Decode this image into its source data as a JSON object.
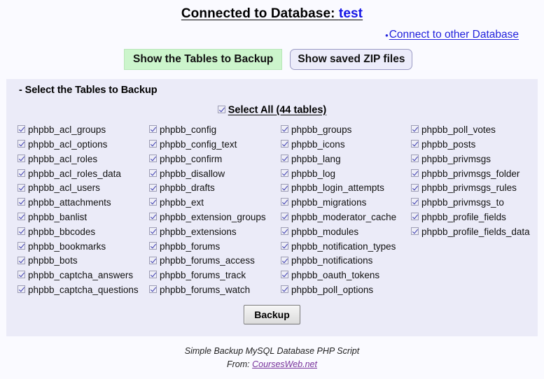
{
  "header": {
    "title_prefix": "Connected to Database: ",
    "database_name": "test",
    "connect_other_link": "Connect to other Database",
    "bullet": "•"
  },
  "toolbar": {
    "show_tables_label": "Show the Tables to Backup",
    "show_zip_label": "Show saved ZIP files",
    "show_tables_color": "#ccf5cc",
    "show_zip_color": "#ececfa"
  },
  "panel": {
    "heading": "- Select the Tables to Backup",
    "select_all_label": "Select All (44 tables)",
    "select_all_checked": true,
    "backup_label": "Backup",
    "columns": [
      {
        "items": [
          {
            "label": "phpbb_acl_groups",
            "checked": true
          },
          {
            "label": "phpbb_acl_options",
            "checked": true
          },
          {
            "label": "phpbb_acl_roles",
            "checked": true
          },
          {
            "label": "phpbb_acl_roles_data",
            "checked": true
          },
          {
            "label": "phpbb_acl_users",
            "checked": true
          },
          {
            "label": "phpbb_attachments",
            "checked": true
          },
          {
            "label": "phpbb_banlist",
            "checked": true
          },
          {
            "label": "phpbb_bbcodes",
            "checked": true
          },
          {
            "label": "phpbb_bookmarks",
            "checked": true
          },
          {
            "label": "phpbb_bots",
            "checked": true
          },
          {
            "label": "phpbb_captcha_answers",
            "checked": true
          },
          {
            "label": "phpbb_captcha_questions",
            "checked": true
          }
        ]
      },
      {
        "items": [
          {
            "label": "phpbb_config",
            "checked": true
          },
          {
            "label": "phpbb_config_text",
            "checked": true
          },
          {
            "label": "phpbb_confirm",
            "checked": true
          },
          {
            "label": "phpbb_disallow",
            "checked": true
          },
          {
            "label": "phpbb_drafts",
            "checked": true
          },
          {
            "label": "phpbb_ext",
            "checked": true
          },
          {
            "label": "phpbb_extension_groups",
            "checked": true
          },
          {
            "label": "phpbb_extensions",
            "checked": true
          },
          {
            "label": "phpbb_forums",
            "checked": true
          },
          {
            "label": "phpbb_forums_access",
            "checked": true
          },
          {
            "label": "phpbb_forums_track",
            "checked": true
          },
          {
            "label": "phpbb_forums_watch",
            "checked": true
          }
        ]
      },
      {
        "items": [
          {
            "label": "phpbb_groups",
            "checked": true
          },
          {
            "label": "phpbb_icons",
            "checked": true
          },
          {
            "label": "phpbb_lang",
            "checked": true
          },
          {
            "label": "phpbb_log",
            "checked": true
          },
          {
            "label": "phpbb_login_attempts",
            "checked": true
          },
          {
            "label": "phpbb_migrations",
            "checked": true
          },
          {
            "label": "phpbb_moderator_cache",
            "checked": true
          },
          {
            "label": "phpbb_modules",
            "checked": true
          },
          {
            "label": "phpbb_notification_types",
            "checked": true
          },
          {
            "label": "phpbb_notifications",
            "checked": true
          },
          {
            "label": "phpbb_oauth_tokens",
            "checked": true
          },
          {
            "label": "phpbb_poll_options",
            "checked": true
          }
        ]
      },
      {
        "items": [
          {
            "label": "phpbb_poll_votes",
            "checked": true
          },
          {
            "label": "phpbb_posts",
            "checked": true
          },
          {
            "label": "phpbb_privmsgs",
            "checked": true
          },
          {
            "label": "phpbb_privmsgs_folder",
            "checked": true
          },
          {
            "label": "phpbb_privmsgs_rules",
            "checked": true
          },
          {
            "label": "phpbb_privmsgs_to",
            "checked": true
          },
          {
            "label": "phpbb_profile_fields",
            "checked": true
          },
          {
            "label": "phpbb_profile_fields_data",
            "checked": true
          }
        ]
      }
    ]
  },
  "footer": {
    "line1": "Simple Backup MySQL Database PHP Script",
    "line2_prefix": "From: ",
    "link_text": "CoursesWeb.net"
  }
}
